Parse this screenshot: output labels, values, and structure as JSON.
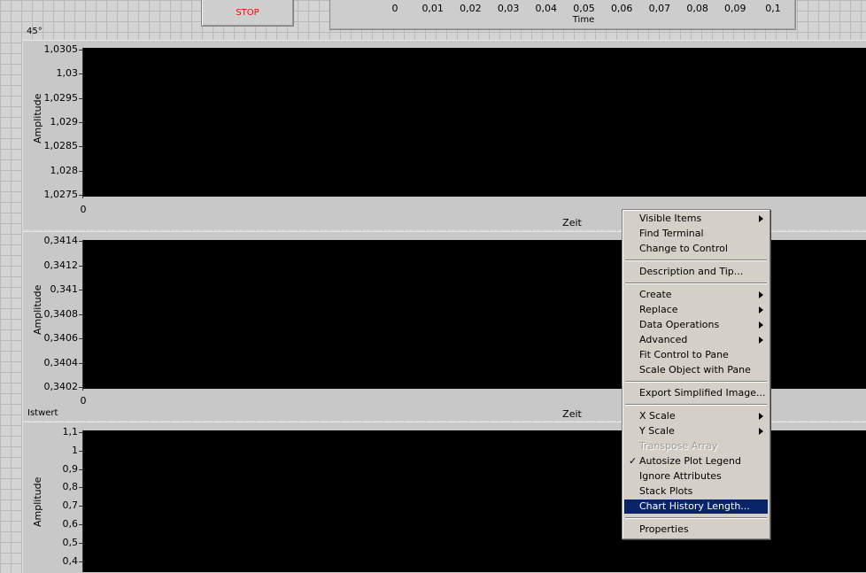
{
  "stop_button": {
    "label": "STOP"
  },
  "top_chart_axis": {
    "ticks": [
      "0",
      "0,01",
      "0,02",
      "0,03",
      "0,04",
      "0,05",
      "0,06",
      "0,07",
      "0,08",
      "0,09",
      "0,1"
    ],
    "xlabel": "Time"
  },
  "angle_label": "45°",
  "chart1": {
    "ylabel": "Amplitude",
    "yticks": [
      "1,0305",
      "1,03",
      "1,0295",
      "1,029",
      "1,0285",
      "1,028",
      "1,0275"
    ],
    "x_start": "0",
    "xlabel": "Zeit"
  },
  "chart2": {
    "ylabel": "Amplitude",
    "yticks": [
      "0,3414",
      "0,3412",
      "0,341",
      "0,3408",
      "0,3406",
      "0,3404",
      "0,3402"
    ],
    "x_start": "0",
    "xlabel": "Zeit"
  },
  "chart3": {
    "title": "Istwert",
    "ylabel": "Amplitude",
    "yticks": [
      "1,1",
      "1",
      "0,9",
      "0,8",
      "0,7",
      "0,6",
      "0,5",
      "0,4"
    ]
  },
  "context_menu": {
    "items": [
      {
        "label": "Visible Items",
        "submenu": true
      },
      {
        "label": "Find Terminal"
      },
      {
        "label": "Change to Control"
      },
      {
        "label": "Description and Tip..."
      },
      {
        "label": "Create",
        "submenu": true
      },
      {
        "label": "Replace",
        "submenu": true
      },
      {
        "label": "Data Operations",
        "submenu": true
      },
      {
        "label": "Advanced",
        "submenu": true
      },
      {
        "label": "Fit Control to Pane"
      },
      {
        "label": "Scale Object with Pane"
      },
      {
        "label": "Export Simplified Image..."
      },
      {
        "label": "X Scale",
        "submenu": true
      },
      {
        "label": "Y Scale",
        "submenu": true
      },
      {
        "label": "Transpose Array",
        "disabled": true
      },
      {
        "label": "Autosize Plot Legend",
        "checked": true
      },
      {
        "label": "Ignore Attributes"
      },
      {
        "label": "Stack Plots"
      },
      {
        "label": "Chart History Length...",
        "selected": true
      },
      {
        "label": "Properties"
      }
    ]
  }
}
